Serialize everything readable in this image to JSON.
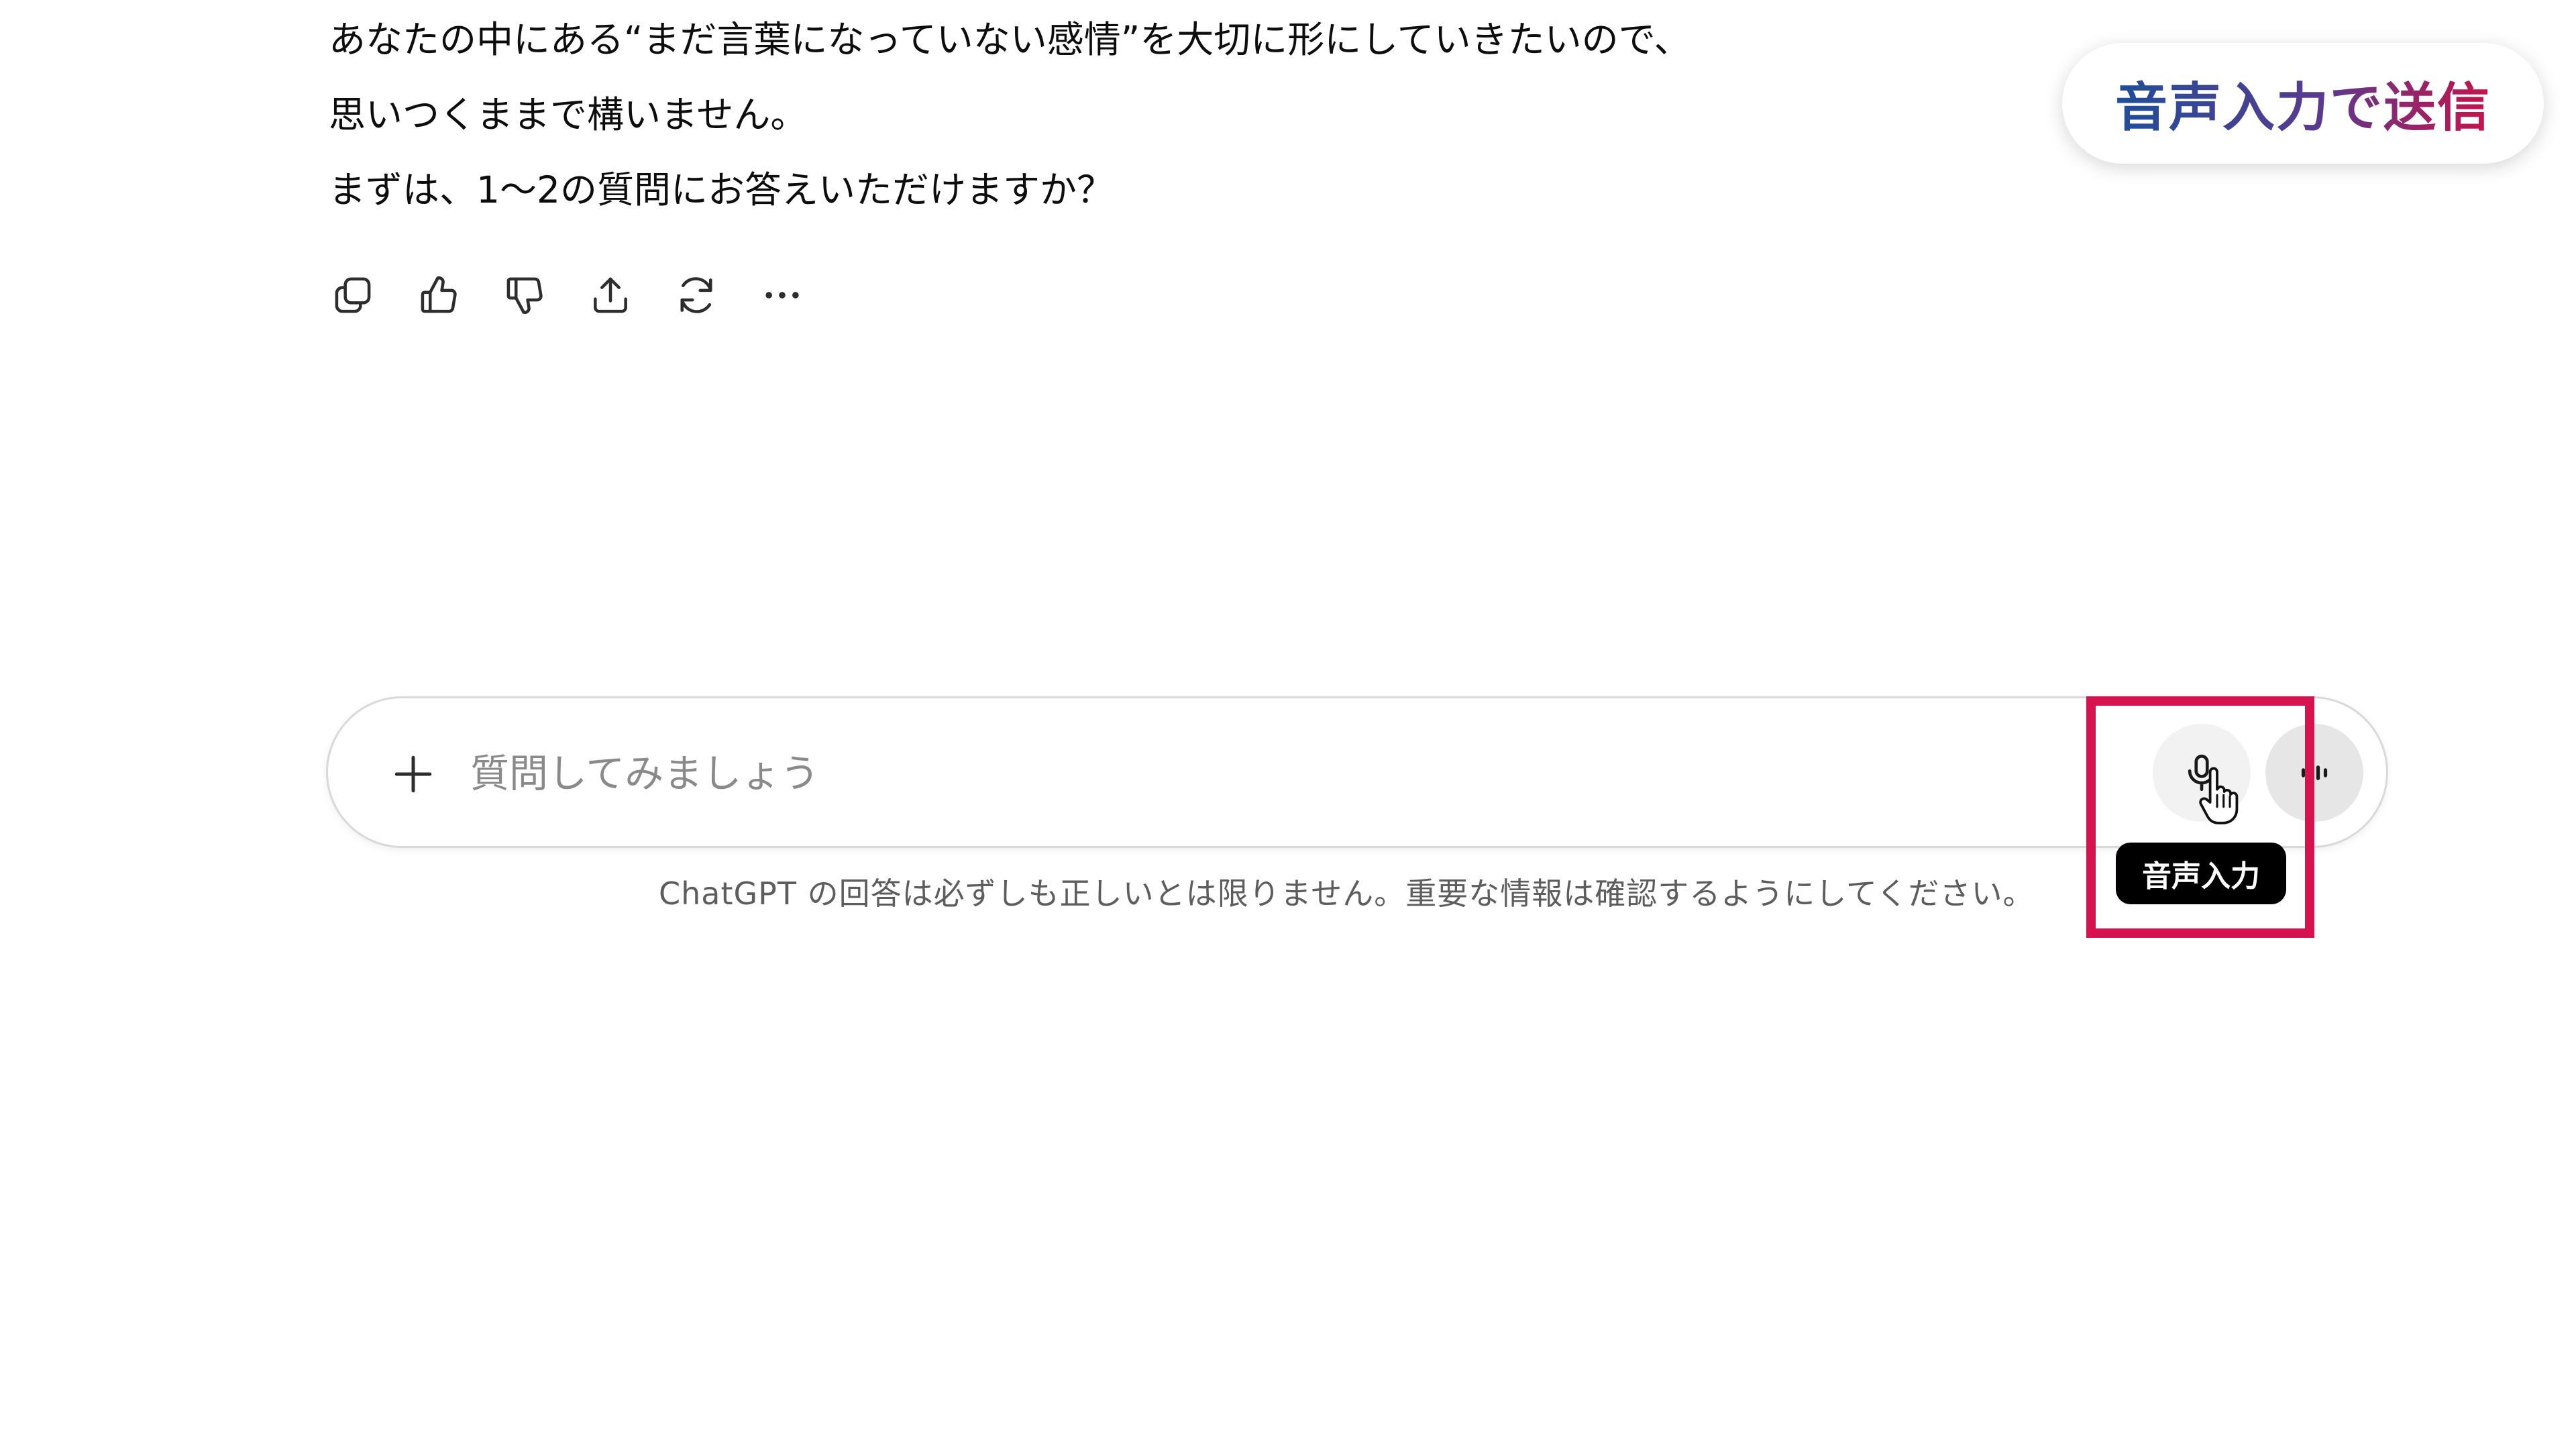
{
  "message": {
    "lines": [
      "あなたの中にある“まだ言葉になっていない感情”を大切に形にしていきたいので、",
      "思いつくままで構いません。",
      "まずは、1〜2の質問にお答えいただけますか？"
    ]
  },
  "message_actions": [
    "copy-icon",
    "thumbs-up-icon",
    "thumbs-down-icon",
    "share-icon",
    "regenerate-icon",
    "more-icon"
  ],
  "badge": {
    "label": "音声入力で送信"
  },
  "composer": {
    "placeholder": "質問してみましょう",
    "value": "",
    "plus_icon": "plus-icon",
    "mic_icon": "microphone-icon",
    "voice_icon": "voice-mode-icon"
  },
  "tooltip": {
    "label": "音声入力"
  },
  "disclaimer": "ChatGPT の回答は必ずしも正しいとは限りません。重要な情報は確認するようにしてください。",
  "colors": {
    "highlight": "#d6124f",
    "badge_gradient_start": "#1f4e9a",
    "badge_gradient_end": "#c8124a",
    "text": "#0d0d0d",
    "placeholder": "#8a8a8a",
    "tooltip_bg": "#000000"
  }
}
